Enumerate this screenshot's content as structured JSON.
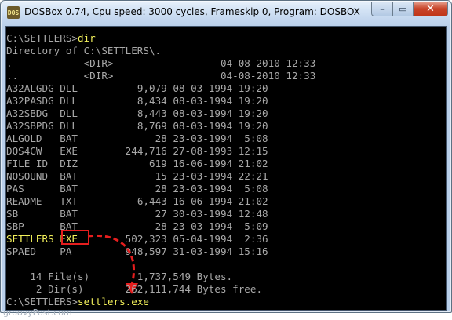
{
  "window": {
    "title": "DOSBox 0.74, Cpu speed:     3000 cycles, Frameskip  0, Program:   DOSBOX",
    "icon_text": "DOS",
    "buttons": {
      "minimize": "–",
      "maximize": "▭",
      "close": "✕"
    }
  },
  "console": {
    "prompt1": "C:\\SETTLERS>",
    "command1": "dir",
    "directory_line": "Directory of C:\\SETTLERS\\.",
    "entries": [
      {
        "name": ".",
        "ext": "",
        "size": "<DIR>",
        "date": "04-08-2010",
        "time": "12:33"
      },
      {
        "name": "..",
        "ext": "",
        "size": "<DIR>",
        "date": "04-08-2010",
        "time": "12:33"
      },
      {
        "name": "A32ALGDG",
        "ext": "DLL",
        "size": "9,079",
        "date": "08-03-1994",
        "time": "19:20"
      },
      {
        "name": "A32PASDG",
        "ext": "DLL",
        "size": "8,434",
        "date": "08-03-1994",
        "time": "19:20"
      },
      {
        "name": "A32SBDG",
        "ext": "DLL",
        "size": "8,443",
        "date": "08-03-1994",
        "time": "19:20"
      },
      {
        "name": "A32SBPDG",
        "ext": "DLL",
        "size": "8,769",
        "date": "08-03-1994",
        "time": "19:20"
      },
      {
        "name": "ALGOLD",
        "ext": "BAT",
        "size": "28",
        "date": "23-03-1994",
        "time": "5:08"
      },
      {
        "name": "DOS4GW",
        "ext": "EXE",
        "size": "244,716",
        "date": "27-08-1993",
        "time": "12:15"
      },
      {
        "name": "FILE_ID",
        "ext": "DIZ",
        "size": "619",
        "date": "16-06-1994",
        "time": "21:02"
      },
      {
        "name": "NOSOUND",
        "ext": "BAT",
        "size": "15",
        "date": "23-03-1994",
        "time": "22:21"
      },
      {
        "name": "PAS",
        "ext": "BAT",
        "size": "28",
        "date": "23-03-1994",
        "time": "5:08"
      },
      {
        "name": "README",
        "ext": "TXT",
        "size": "6,443",
        "date": "16-06-1994",
        "time": "21:02"
      },
      {
        "name": "SB",
        "ext": "BAT",
        "size": "27",
        "date": "30-03-1994",
        "time": "12:48"
      },
      {
        "name": "SBP",
        "ext": "BAT",
        "size": "28",
        "date": "23-03-1994",
        "time": "5:09"
      },
      {
        "name": "SETTLERS",
        "ext": "EXE",
        "size": "502,323",
        "date": "05-04-1994",
        "time": "2:36"
      },
      {
        "name": "SPAED",
        "ext": "PA",
        "size": "948,597",
        "date": "31-03-1994",
        "time": "15:16"
      }
    ],
    "summary_files": "    14 File(s)        1,737,549 Bytes.",
    "summary_dirs": "     2 Dir(s)       262,111,744 Bytes free.",
    "prompt2": "C:\\SETTLERS>",
    "command2": "settlers.exe"
  },
  "annotation": {
    "highlight_color": "#e51e1e",
    "command_color": "#f4f25b"
  },
  "watermark": "groovyPost.com"
}
